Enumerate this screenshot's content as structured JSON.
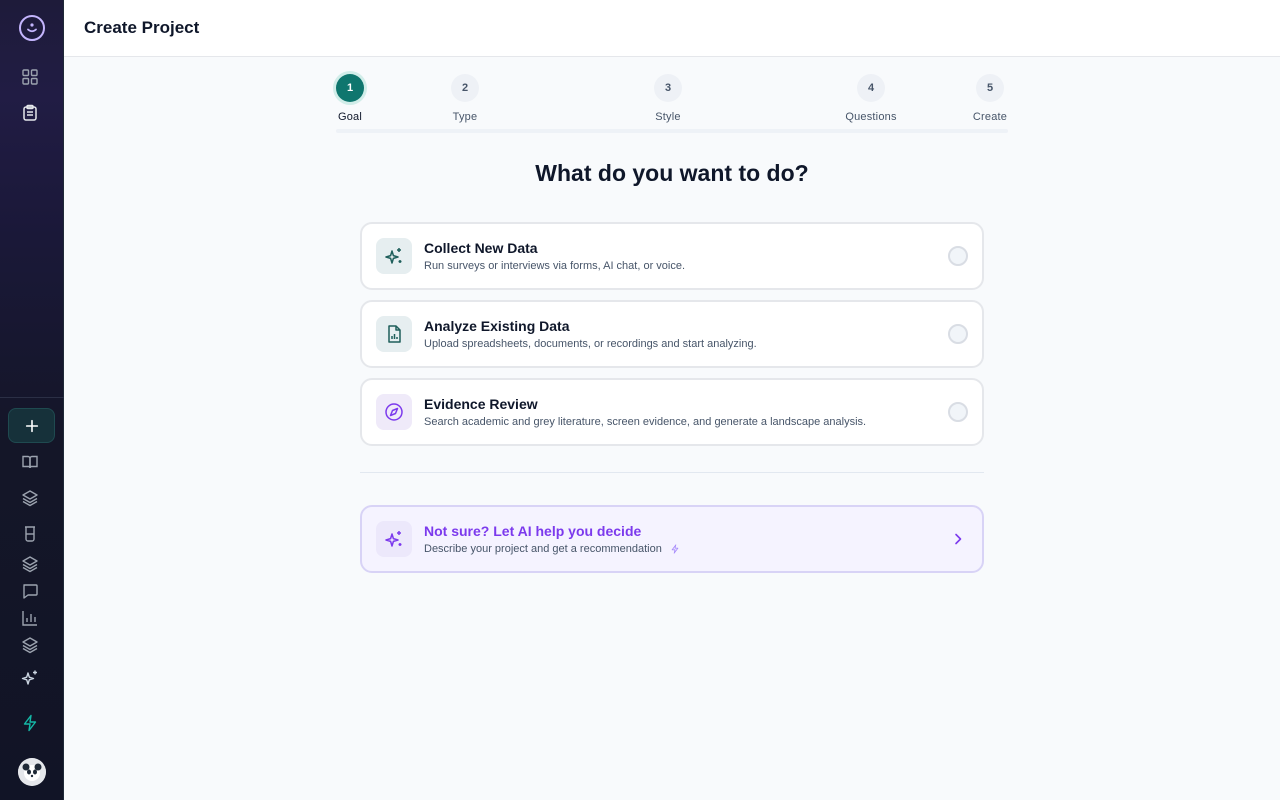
{
  "header": {
    "title": "Create Project"
  },
  "sidebar": {
    "icons": [
      "logo-icon",
      "dashboard-icon",
      "clipboard-icon",
      "plus-icon",
      "book-icon",
      "layers-icon",
      "beaker-icon",
      "stack-icon",
      "chat-icon",
      "bar-chart-icon",
      "layers-icon",
      "sparkles-icon",
      "bolt-icon",
      "avatar"
    ]
  },
  "stepper": {
    "steps": [
      {
        "num": "1",
        "label": "Goal",
        "active": true
      },
      {
        "num": "2",
        "label": "Type",
        "active": false
      },
      {
        "num": "3",
        "label": "Style",
        "active": false
      },
      {
        "num": "4",
        "label": "Questions",
        "active": false
      },
      {
        "num": "5",
        "label": "Create",
        "active": false
      }
    ]
  },
  "main": {
    "title": "What do you want to do?",
    "options": [
      {
        "title": "Collect New Data",
        "description": "Run surveys or interviews via forms, AI chat, or voice.",
        "icon": "sparkles-icon"
      },
      {
        "title": "Analyze Existing Data",
        "description": "Upload spreadsheets, documents, or recordings and start analyzing.",
        "icon": "file-chart-icon"
      },
      {
        "title": "Evidence Review",
        "description": "Search academic and grey literature, screen evidence, and generate a landscape analysis.",
        "icon": "compass-icon"
      }
    ],
    "ai_help": {
      "title": "Not sure? Let AI help you decide",
      "description": "Describe your project and get a recommendation",
      "icon": "sparkles-icon"
    }
  },
  "colors": {
    "accent": "#0f766e",
    "purple": "#7c3aed"
  }
}
